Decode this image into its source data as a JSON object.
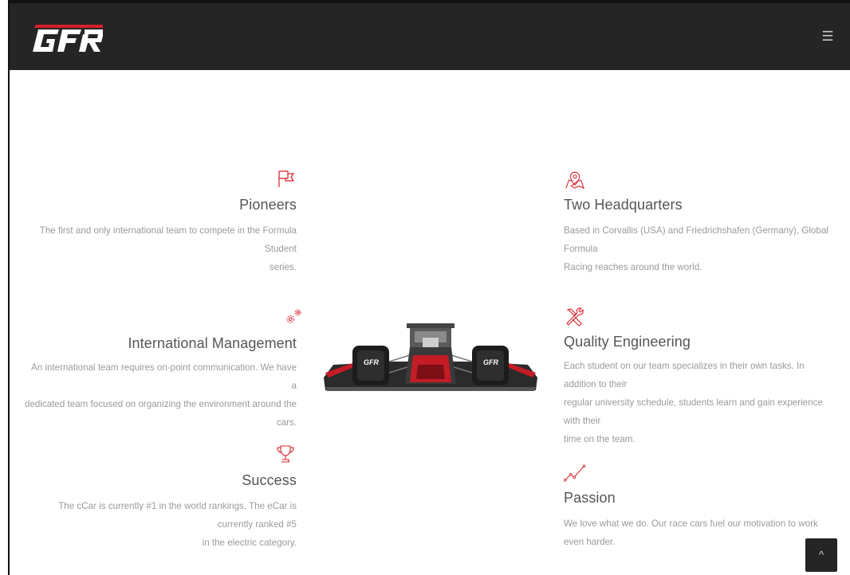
{
  "header": {
    "logo_text": "GFR",
    "menu_icon": "hamburger-menu-icon"
  },
  "colors": {
    "accent": "#d71f2a",
    "header_bg": "#252525",
    "title": "#555555",
    "text": "#9a9a9a"
  },
  "features": {
    "pioneers": {
      "icon": "flag-icon",
      "title": "Pioneers",
      "line1": "The first and only international team to compete in the Formula Student",
      "line2": "series."
    },
    "headquarters": {
      "icon": "map-pin-icon",
      "title": "Two Headquarters",
      "line1": "Based in Corvallis (USA) and Friedrichshafen (Germany), Global Formula",
      "line2": "Racing reaches around the world."
    },
    "management": {
      "icon": "gears-icon",
      "title": "International Management",
      "line1": "An international team requires on-point communication. We have a",
      "line2": "dedicated team focused on organizing the environment around the cars."
    },
    "engineering": {
      "icon": "tools-icon",
      "title": "Quality Engineering",
      "line1": "Each student on our team specializes in their own tasks. In addition to their",
      "line2": "regular university schedule, students learn and gain experience with their",
      "line3": "time on the team."
    },
    "success": {
      "icon": "trophy-icon",
      "title": "Success",
      "line1": "The cCar is currently #1 in the world rankings. The eCar is currently ranked #5",
      "line2": "in the electric category."
    },
    "passion": {
      "icon": "line-chart-icon",
      "title": "Passion",
      "line1": "We love what we do. Our race cars fuel our motivation to work even harder."
    }
  },
  "car_image": {
    "decal": "GFR"
  },
  "back_to_top": {
    "icon": "chevron-up-icon",
    "label": "^"
  }
}
